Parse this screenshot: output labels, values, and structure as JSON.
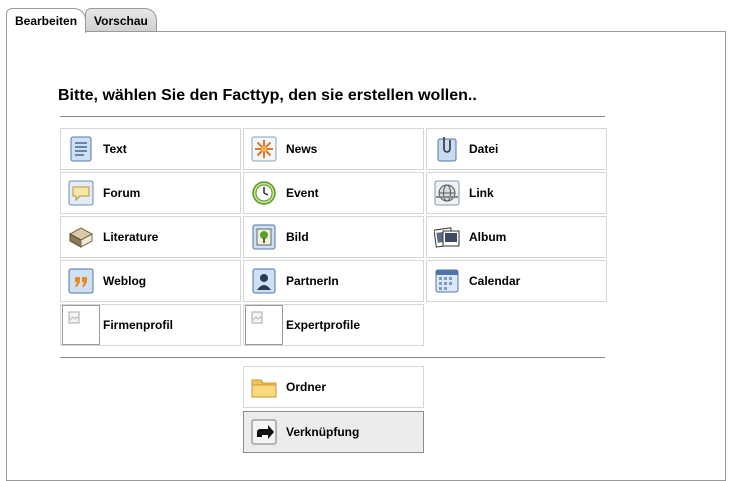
{
  "tabs": [
    {
      "label": "Bearbeiten",
      "active": true
    },
    {
      "label": "Vorschau",
      "active": false
    }
  ],
  "heading": "Bitte, wählen Sie den Facttyp, den sie erstellen wollen..",
  "fact_types": [
    {
      "label": "Text",
      "icon": "document-text-icon"
    },
    {
      "label": "News",
      "icon": "news-starburst-icon"
    },
    {
      "label": "Datei",
      "icon": "file-paperclip-icon"
    },
    {
      "label": "Forum",
      "icon": "speech-bubble-icon"
    },
    {
      "label": "Event",
      "icon": "clock-icon"
    },
    {
      "label": "Link",
      "icon": "globe-link-icon"
    },
    {
      "label": "Literature",
      "icon": "book-icon"
    },
    {
      "label": "Bild",
      "icon": "picture-icon"
    },
    {
      "label": "Album",
      "icon": "photo-album-icon"
    },
    {
      "label": "Weblog",
      "icon": "quote-icon"
    },
    {
      "label": "PartnerIn",
      "icon": "person-card-icon"
    },
    {
      "label": "Calendar",
      "icon": "calendar-icon"
    },
    {
      "label": "Firmenprofil",
      "icon": "broken-image-icon"
    },
    {
      "label": "Expertprofile",
      "icon": "broken-image-icon"
    }
  ],
  "extra_items": [
    {
      "label": "Ordner",
      "icon": "folder-icon",
      "selected": false
    },
    {
      "label": "Verknüpfung",
      "icon": "shortcut-arrow-icon",
      "selected": true
    }
  ]
}
